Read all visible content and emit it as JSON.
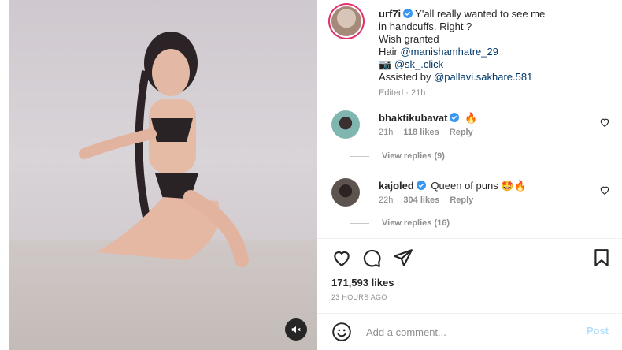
{
  "post": {
    "author": "urf7i",
    "caption_lines": [
      "Y'all really wanted to see me",
      "in handcuffs. Right ?",
      "Wish granted"
    ],
    "hair_label": "Hair",
    "hair_handle": "@manishamhatre_29",
    "camera_emoji": "📷",
    "camera_handle": "@sk_.click",
    "assisted_label": "Assisted by",
    "assisted_handle": "@pallavi.sakhare.581",
    "edited_meta": "Edited · 21h"
  },
  "comments": [
    {
      "username": "bhaktikubavat",
      "text": "🔥",
      "time": "21h",
      "likes": "118 likes",
      "reply_label": "Reply",
      "view_replies": "View replies (9)"
    },
    {
      "username": "kajoled",
      "text": "Queen of puns 🤩🔥",
      "time": "22h",
      "likes": "304 likes",
      "reply_label": "Reply",
      "view_replies": "View replies (16)"
    }
  ],
  "stats": {
    "likes": "171,593 likes",
    "timestamp": "23 HOURS AGO"
  },
  "composer": {
    "placeholder": "Add a comment...",
    "post_label": "Post"
  },
  "colors": {
    "verified": "#3897f0",
    "link": "#00376b",
    "post_disabled": "#b2dffc"
  },
  "icons": {
    "verified": "verified-badge-icon",
    "heart": "heart-icon",
    "comment": "comment-icon",
    "share": "share-icon",
    "save": "bookmark-icon",
    "mute": "mute-icon",
    "emoji": "emoji-icon"
  }
}
